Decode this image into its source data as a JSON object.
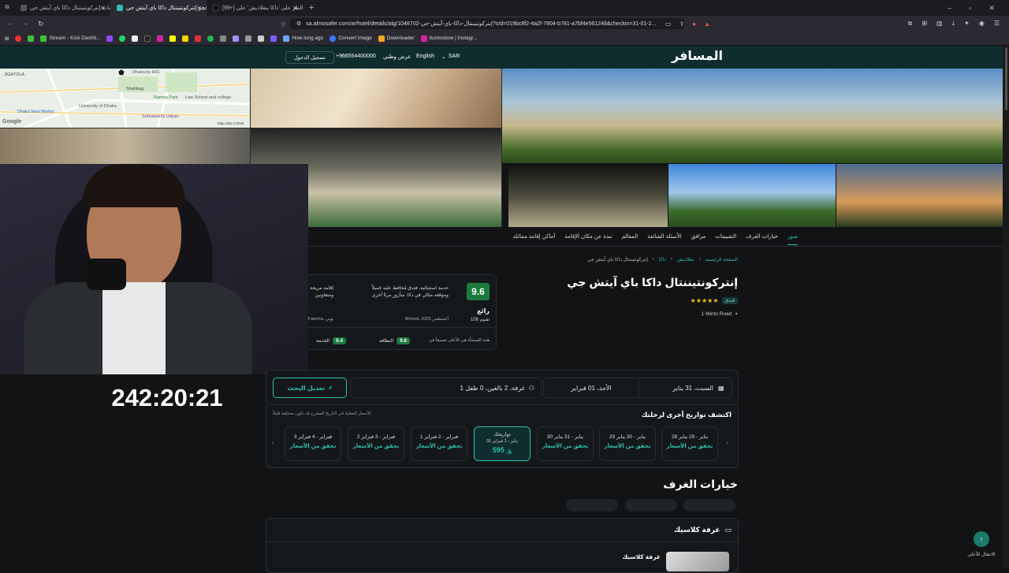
{
  "browser": {
    "tabs": [
      {
        "label": "إقامات إنتركونتيننتال داكا باي آيتش جي",
        "active": false
      },
      {
        "label": "حجز إنتركونتيننتال داكا باي آيتش جي",
        "active": true
      },
      {
        "label": "[99+] الطر على 'داكا بنغلاديش' على tiktok",
        "active": false
      }
    ],
    "url": "sa.almosafer.com/ar/hotel/details/atg/1048702-إنتركونتيننتال-داكا-باي-آيتش-جي?sId=019bc8f2-4a2f-7804-b781-a7bf4e561248&checkin=31-01-2...",
    "bookmarks": [
      "Stream - Kick Dashb...",
      "How long ago",
      "Convert Image",
      "Downloader",
      "huntostore | Instagr..."
    ]
  },
  "site": {
    "logo": "المسافر",
    "currency": "SAR",
    "language": "English",
    "national_offer": "عرض وطني",
    "phone": "+966554400000",
    "login": "تسجيل الدخول"
  },
  "map": {
    "labels": [
      "JIGATOLA",
      "Dhaka by IHG",
      "Shahbag",
      "Ramna Park",
      "University of Dhaka",
      "Suhrawardy Udyan",
      "Dhaka New Market",
      "Law School and college",
      "Google",
      "Map data ©2026"
    ]
  },
  "timer": "242:20:21",
  "page_tabs": [
    "صور",
    "خيارات الغرف",
    "التقييمات",
    "مرافق",
    "الأسئلة الشائعة",
    "المعالم",
    "نبذة عن مكان الإقامة",
    "أماكن إقامة مماثلة"
  ],
  "breadcrumb": [
    "الصفحة الرئيسية",
    "بنغلاديش",
    "داكا",
    "إنتركونتيننتال داكا باي آيتش جي"
  ],
  "hotel": {
    "name": "إنتركونتيننتال داكا باي آيتش جي",
    "stars": "★★★★★",
    "type": "فندق",
    "address": "1 Minto Road"
  },
  "review": {
    "score": "9.6",
    "label": "رائع",
    "count": "106 تقييم",
    "quote": "حدمة استثنائية، فندق مُحافظ عليه جَميلاً وموقعه مثالي في دكا. سأزور مرةً أخرى",
    "author": "Ahmed، أغسطس 2025",
    "quote2": "إقامة مريحة ومتعاونين",
    "author2": "Fatema، يوني",
    "note": "هذه المنشأة هي الأعلى تصنيفاً في",
    "cleanliness_label": "النظافة",
    "cleanliness": "9.6",
    "service_label": "الخدمة",
    "service": "9.4"
  },
  "search": {
    "checkin": "السبت، 31 يناير",
    "checkout": "الأحد، 01 فبراير",
    "guests": "1 غرفة، 2 بالغين، 0 طفل",
    "modify": "تعديل البحث"
  },
  "explore": {
    "title": "اكتشف تواريخ أخرى لرحلتك",
    "note": "الأسعار الفعلية في التاريخ المقترح قد تكون مختلفة قليلاً.",
    "check": "تحقق من الأسعار",
    "dates": [
      {
        "label": "28 يناير - 29 يناير"
      },
      {
        "label": "29 يناير - 30 يناير"
      },
      {
        "label": "30 يناير - 31 يناير"
      },
      {
        "label": "تواريخك",
        "sub": "31 يناير - 1 فبراير",
        "price": "595",
        "selected": true
      },
      {
        "label": "1 فبراير - 2 فبراير"
      },
      {
        "label": "2 فبراير - 3 فبراير"
      },
      {
        "label": "3 فبراير - 4 فبراير"
      }
    ]
  },
  "rooms": {
    "title": "خيارات الغرف",
    "room_name": "غرفة كلاسيك",
    "room_sub": "غرفة كلاسيك"
  },
  "back_to_top": "الانتقال للأعلى",
  "colors": {
    "accent": "#2fbfae",
    "header": "#0f2d2e",
    "score": "#1b7a3e",
    "bg": "#111315"
  }
}
